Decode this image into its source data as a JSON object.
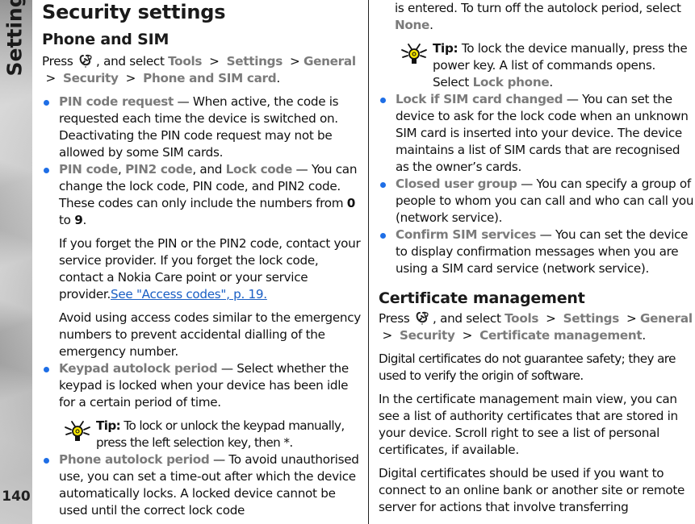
{
  "sidebar": {
    "section_title": "Settings",
    "page_number": "140"
  },
  "left": {
    "title": "Security settings",
    "subtitle": "Phone and SIM",
    "path": {
      "press": "Press",
      "and_select": ", and select",
      "items": [
        "Tools",
        "Settings",
        "General",
        "Security",
        "Phone and SIM card"
      ],
      "sep": ">",
      "end": "."
    },
    "pin_request": {
      "term": "PIN code request",
      "text": " — When active, the code is requested each time the device is switched on. Deactivating the PIN code request may not be allowed by some SIM cards."
    },
    "codes": {
      "term1": "PIN code",
      "sep1": ", ",
      "term2": "PIN2 code",
      "sep2": ", and ",
      "term3": "Lock code",
      "text": " — You can change the lock code, PIN code, and PIN2 code. These codes can only include the numbers from ",
      "from": "0",
      "to_word": " to ",
      "to": "9",
      "end": "."
    },
    "forget_text": "If you forget the PIN or the PIN2 code, contact your service provider. If you forget the lock code, contact a Nokia Care point or your service provider.",
    "forget_link": "See \"Access codes\", p. 19.",
    "avoid_text": "Avoid using access codes similar to the emergency numbers to prevent accidental dialling of the emergency number.",
    "keypad": {
      "term": "Keypad autolock period",
      "text": " — Select whether the keypad is locked when your device has been idle for a certain period of time."
    },
    "tip1": {
      "label": "Tip:",
      "text": " To lock or unlock the keypad manually, press the left selection key, then *."
    },
    "phone_autolock": {
      "term": "Phone autolock period",
      "text": " — To avoid unauthorised use, you can set a time-out after which the device automatically locks. A locked device cannot be used until the correct lock code"
    }
  },
  "right": {
    "cont_text": "is entered. To turn off the autolock period, select ",
    "cont_term": "None",
    "cont_end": ".",
    "tip2": {
      "label": "Tip:",
      "text": " To lock the device manually, press the power key. A list of commands opens. Select ",
      "term": "Lock phone",
      "end": "."
    },
    "sim_changed": {
      "term": "Lock if SIM card changed",
      "text": " — You can set the device to ask for the lock code when an unknown SIM card is inserted into your device. The device maintains a list of SIM cards that are recognised as the owner’s cards."
    },
    "closed_group": {
      "term": "Closed user group",
      "text": " — You can specify a group of people to whom you can call and who can call you (network service)."
    },
    "confirm_sim": {
      "term": "Confirm SIM services",
      "text": " — You can set the device to display confirmation messages when you are using a SIM card service (network service)."
    },
    "cert_title": "Certificate management",
    "path": {
      "press": "Press",
      "and_select": ", and select",
      "items": [
        "Tools",
        "Settings",
        "General",
        "Security",
        "Certificate management"
      ],
      "sep": ">",
      "end": "."
    },
    "para1": "Digital certificates do not guarantee safety; they are used to verify the origin of software.",
    "para2": "In the certificate management main view, you can see a list of authority certificates that are stored in your device. Scroll right to see a list of personal certificates, if available.",
    "para3": "Digital certificates should be used if you want to connect to an online bank or another site or remote server for actions that involve transferring"
  }
}
